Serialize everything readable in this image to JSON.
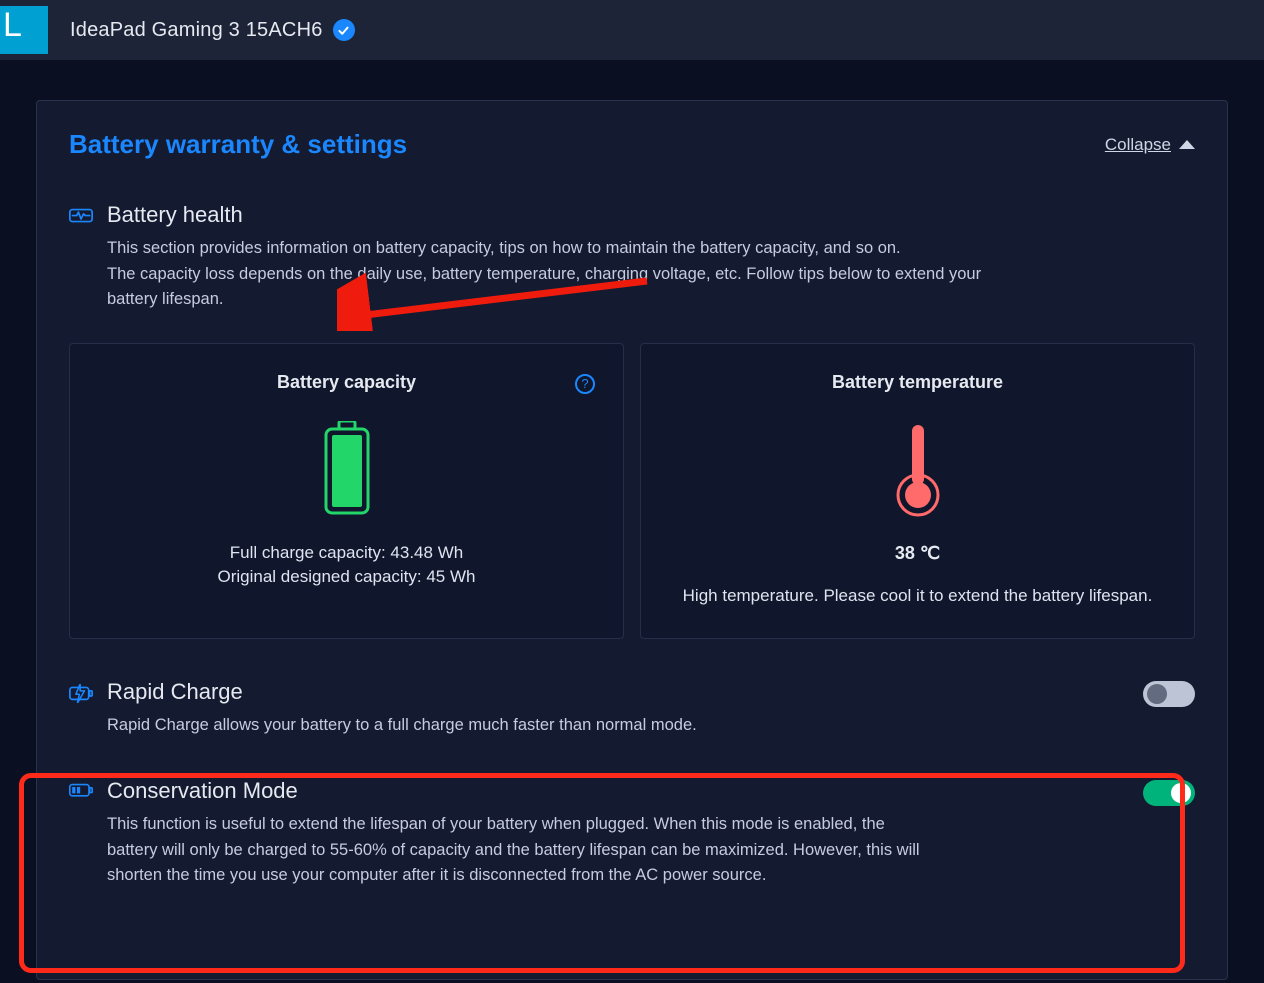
{
  "titlebar": {
    "device_name": "IdeaPad Gaming 3 15ACH6"
  },
  "section": {
    "title": "Battery warranty & settings",
    "collapse_label": "Collapse"
  },
  "battery_health": {
    "title": "Battery health",
    "desc_line1": "This section provides information on battery capacity, tips on how to maintain the battery capacity, and so on.",
    "desc_line2": "The capacity loss depends on the daily use, battery temperature, charging voltage, etc. Follow tips below to extend your battery lifespan."
  },
  "capacity_tile": {
    "title": "Battery capacity",
    "full_charge_label": "Full charge capacity: 43.48 Wh",
    "original_label": "Original designed capacity: 45 Wh"
  },
  "temperature_tile": {
    "title": "Battery temperature",
    "value": "38 ℃",
    "message": "High temperature. Please cool it to extend the battery lifespan."
  },
  "rapid_charge": {
    "title": "Rapid Charge",
    "desc": "Rapid Charge allows your battery to a full charge much faster than normal mode.",
    "enabled": false
  },
  "conservation": {
    "title": "Conservation Mode",
    "desc": "This function is useful to extend the lifespan of your battery when plugged.\nWhen this mode is enabled, the battery will only be charged to 55-60% of capacity and the battery lifespan can be maximized. However, this will shorten the time you use your computer after it is disconnected from the AC power source.",
    "enabled": true
  },
  "colors": {
    "accent": "#1b87ff",
    "good": "#23d66a",
    "warn": "#ff6a6a",
    "toggle_on": "#00b37a"
  }
}
